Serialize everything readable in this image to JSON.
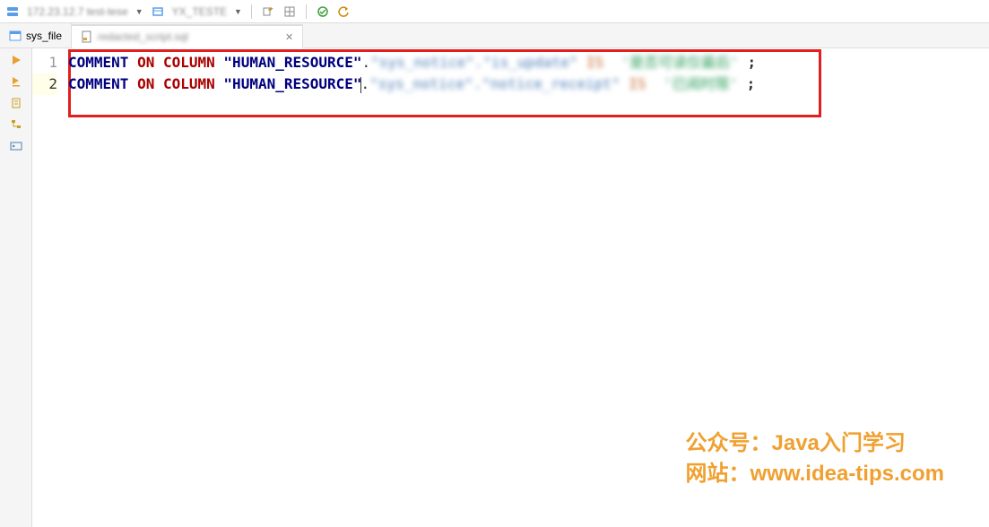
{
  "toolbar": {
    "connection": "172.23.12.7 test-tese",
    "schema": "YX_TESTE"
  },
  "tabs": [
    {
      "label": "sys_file",
      "active": false,
      "closable": false
    },
    {
      "label": "redacted_script.sql",
      "active": true,
      "closable": true
    }
  ],
  "editor": {
    "lines": [
      {
        "num": "1",
        "tokens": {
          "kw1": "COMMENT",
          "kw2": "ON",
          "kw3": "COLUMN",
          "str": "\"HUMAN_RESOURCE\"",
          "dot": ".",
          "blur1": "\"sys_notice\".\"is_update\"",
          "blur2": "IS",
          "blur3": "'是否可读仅最后'",
          "semi": ";"
        }
      },
      {
        "num": "2",
        "tokens": {
          "kw1": "COMMENT",
          "kw2": "ON",
          "kw3": "COLUMN",
          "str": "\"HUMAN_RESOURCE\"",
          "dot": ".",
          "blur1": "\"sys_notice\".\"notice_receipt\"",
          "blur2": "IS",
          "blur3": "'已阅时限'",
          "semi": ";"
        }
      }
    ]
  },
  "watermark": {
    "line1": "公众号：Java入门学习",
    "line2": "网站：www.idea-tips.com"
  }
}
